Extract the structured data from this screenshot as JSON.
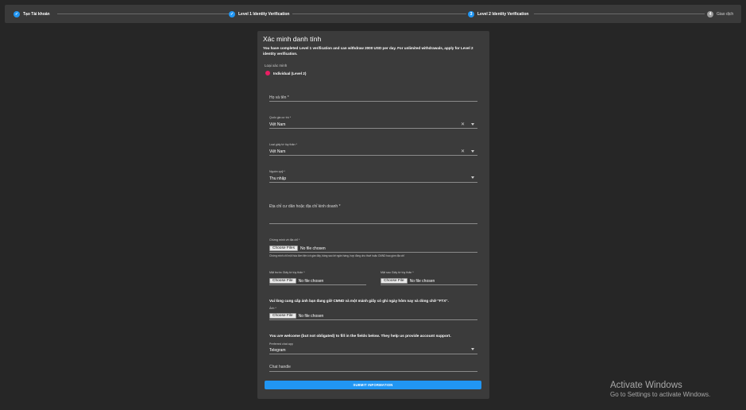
{
  "stepper": {
    "steps": [
      {
        "label": "Tạo Tài khoản",
        "state": "done",
        "icon": "check-icon"
      },
      {
        "label": "Level 1 Identity Verification",
        "state": "done",
        "icon": "check-icon"
      },
      {
        "label": "Level 2 Identity Verification",
        "state": "active",
        "number": "3"
      },
      {
        "label": "Giao dịch",
        "state": "pending",
        "number": "4"
      }
    ]
  },
  "form": {
    "title": "Xác minh danh tính",
    "description": "You have completed Level 1 verification and can withdraw 2000 USD per day. For unlimited withdrawals, apply for Level 2 identity verification.",
    "verification_type_label": "Loại xác minh",
    "verification_option": "Individual (Level 2)",
    "full_name": {
      "label": "Họ và tên *",
      "value": ""
    },
    "nationality": {
      "label": "Quốc gia cư trú *",
      "value": "Việt Nam"
    },
    "id_type": {
      "label": "Loại giấy tờ tùy thân *",
      "value": "Việt Nam"
    },
    "fund_source": {
      "label": "Nguồn quỹ *",
      "value": "Thu nhập"
    },
    "address": {
      "label": "Địa chỉ cư dân hoặc địa chỉ kinh doanh *",
      "value": ""
    },
    "proof_of_address": {
      "label": "Chứng minh về địa chỉ *",
      "button": "Choose Files",
      "status": "No file chosen",
      "hint": "Chứng minh chỉ một hóa đơn tiện ích gần đây, bảng sao kê ngân hàng, hợp đồng cho thuê hoặc CMND bao gồm địa chỉ"
    },
    "id_front": {
      "label": "Mặt trước Giấy tờ tùy thân *",
      "button": "Choose File",
      "status": "No file chosen"
    },
    "id_back": {
      "label": "Mặt sau Giấy tờ tùy thân *",
      "button": "Choose File",
      "status": "No file chosen"
    },
    "selfie_note": "Vui lòng cung cấp ảnh bạn đang giữ CMND và một mảnh giấy có ghi ngày hôm nay và dòng chữ \"FTX\".",
    "selfie": {
      "label": "Ảnh *",
      "button": "Choose File",
      "status": "No file chosen"
    },
    "optional_note": "You are welcome (but not obligated) to fill in the fields below. They help us provide account support.",
    "chat_app": {
      "label": "Preferred chat app",
      "value": "Telegram"
    },
    "chat_handle": {
      "placeholder": "Chat handle"
    },
    "submit_label": "SUBMIT INFORMATION"
  },
  "watermark": {
    "line1": "Activate Windows",
    "line2": "Go to Settings to activate Windows."
  },
  "colors": {
    "accent": "#2196f3",
    "radio": "#e91e63",
    "card": "#3b3b3b",
    "background": "#262626"
  }
}
